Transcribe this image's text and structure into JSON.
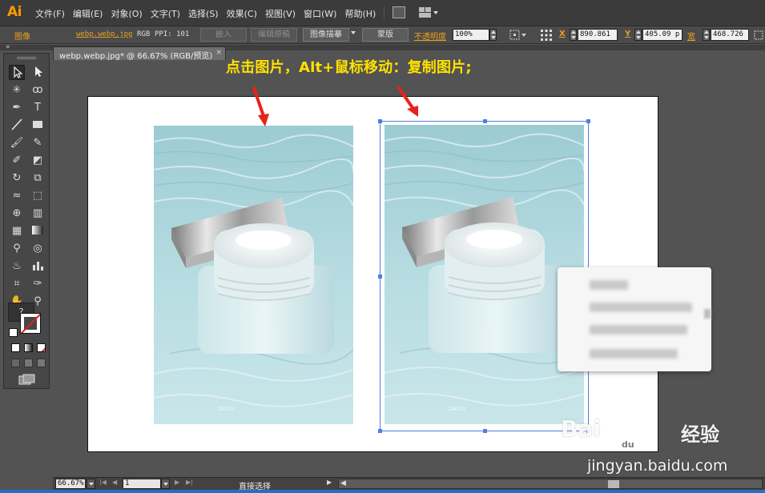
{
  "app": {
    "logo": "Ai"
  },
  "menubar": {
    "items": [
      "文件(F)",
      "编辑(E)",
      "对象(O)",
      "文字(T)",
      "选择(S)",
      "效果(C)",
      "视图(V)",
      "窗口(W)",
      "帮助(H)"
    ]
  },
  "control_bar": {
    "object_type": "图像",
    "filename": "webp.webp.jpg",
    "color_mode": "RGB",
    "ppi_label": "PPI: 101",
    "embed_button": "嵌入",
    "edit_original_button": "编辑原稿",
    "image_trace_button": "图像描摹",
    "mask_button": "蒙版",
    "opacity_label": "不透明度",
    "opacity_value": "100%",
    "x_label": "X",
    "x_value": "890.861",
    "y_label": "Y",
    "y_value": "405.09 p",
    "width_label": "宽",
    "width_value": "468.726"
  },
  "document": {
    "tab_title": "webp.webp.jpg* @ 66.67% (RGB/预览)",
    "close_glyph": "×"
  },
  "annotation": {
    "caption": "点击图片，Alt+鼠标移动：复制图片;",
    "arrow_color": "#e8221b"
  },
  "image_labels": {
    "brand_text": "ZAOTU"
  },
  "tools": [
    "selection-tool",
    "direct-selection-tool",
    "magic-wand-tool",
    "lasso-tool",
    "pen-tool",
    "type-tool",
    "line-tool",
    "rectangle-tool",
    "paintbrush-tool",
    "pencil-tool",
    "blob-brush-tool",
    "eraser-tool",
    "rotate-tool",
    "scale-tool",
    "width-tool",
    "free-transform-tool",
    "shape-builder-tool",
    "perspective-grid-tool",
    "mesh-tool",
    "gradient-tool",
    "eyedropper-tool",
    "blend-tool",
    "symbol-sprayer-tool",
    "column-graph-tool",
    "artboard-tool",
    "slice-tool",
    "hand-tool",
    "zoom-tool"
  ],
  "toolbox": {
    "fill_stroke_question": "?"
  },
  "statusbar": {
    "zoom": "66.67%",
    "page": "1",
    "status": "直接选择"
  },
  "watermark": {
    "logo": "Bai",
    "logo_suffix": "经验",
    "url": "jingyan.baidu.com"
  },
  "colors": {
    "accent_orange": "#e8a020",
    "caption_yellow": "#ffe100",
    "selection_blue": "#4f7fe0"
  }
}
